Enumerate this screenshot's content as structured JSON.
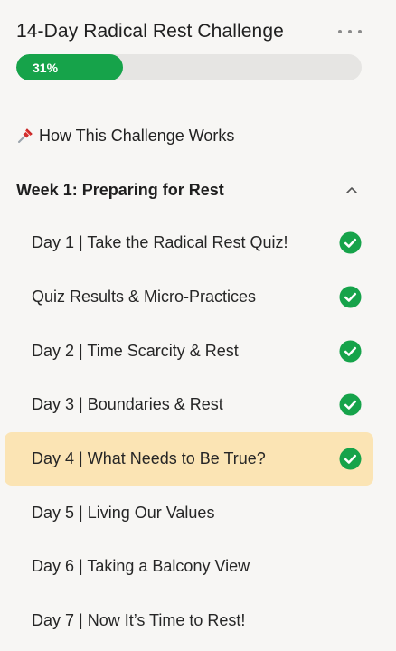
{
  "course": {
    "title": "14-Day Radical Rest Challenge",
    "progress_label": "31%",
    "progress_fraction": 0.31
  },
  "how_link": {
    "icon": "pushpin-icon",
    "label": "How This Challenge Works"
  },
  "week1": {
    "title": "Week 1: Preparing for Rest",
    "expanded": true,
    "lessons": [
      {
        "label": "Day 1 | Take the Radical Rest Quiz!",
        "completed": true,
        "active": false
      },
      {
        "label": "Quiz Results & Micro-Practices",
        "completed": true,
        "active": false
      },
      {
        "label": "Day 2 | Time Scarcity & Rest",
        "completed": true,
        "active": false
      },
      {
        "label": "Day 3 | Boundaries & Rest",
        "completed": true,
        "active": false
      },
      {
        "label": "Day 4 | What Needs to Be True?",
        "completed": true,
        "active": true
      },
      {
        "label": "Day 5 | Living Our Values",
        "completed": false,
        "active": false
      },
      {
        "label": "Day 6 | Taking a Balcony View",
        "completed": false,
        "active": false
      },
      {
        "label": "Day 7 | Now It’s Time to Rest!",
        "completed": false,
        "active": false
      }
    ]
  },
  "colors": {
    "accent_green": "#16a34a",
    "active_highlight": "#fbe4b4",
    "track": "#e6e5e3"
  }
}
